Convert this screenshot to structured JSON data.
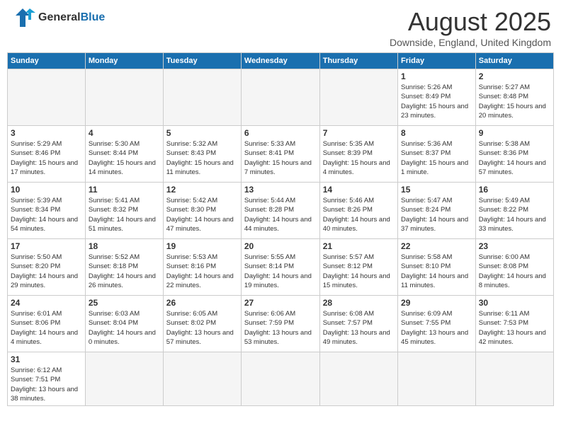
{
  "header": {
    "logo_general": "General",
    "logo_blue": "Blue",
    "month_title": "August 2025",
    "location": "Downside, England, United Kingdom"
  },
  "weekdays": [
    "Sunday",
    "Monday",
    "Tuesday",
    "Wednesday",
    "Thursday",
    "Friday",
    "Saturday"
  ],
  "weeks": [
    [
      {
        "day": "",
        "info": ""
      },
      {
        "day": "",
        "info": ""
      },
      {
        "day": "",
        "info": ""
      },
      {
        "day": "",
        "info": ""
      },
      {
        "day": "",
        "info": ""
      },
      {
        "day": "1",
        "info": "Sunrise: 5:26 AM\nSunset: 8:49 PM\nDaylight: 15 hours\nand 23 minutes."
      },
      {
        "day": "2",
        "info": "Sunrise: 5:27 AM\nSunset: 8:48 PM\nDaylight: 15 hours\nand 20 minutes."
      }
    ],
    [
      {
        "day": "3",
        "info": "Sunrise: 5:29 AM\nSunset: 8:46 PM\nDaylight: 15 hours\nand 17 minutes."
      },
      {
        "day": "4",
        "info": "Sunrise: 5:30 AM\nSunset: 8:44 PM\nDaylight: 15 hours\nand 14 minutes."
      },
      {
        "day": "5",
        "info": "Sunrise: 5:32 AM\nSunset: 8:43 PM\nDaylight: 15 hours\nand 11 minutes."
      },
      {
        "day": "6",
        "info": "Sunrise: 5:33 AM\nSunset: 8:41 PM\nDaylight: 15 hours\nand 7 minutes."
      },
      {
        "day": "7",
        "info": "Sunrise: 5:35 AM\nSunset: 8:39 PM\nDaylight: 15 hours\nand 4 minutes."
      },
      {
        "day": "8",
        "info": "Sunrise: 5:36 AM\nSunset: 8:37 PM\nDaylight: 15 hours\nand 1 minute."
      },
      {
        "day": "9",
        "info": "Sunrise: 5:38 AM\nSunset: 8:36 PM\nDaylight: 14 hours\nand 57 minutes."
      }
    ],
    [
      {
        "day": "10",
        "info": "Sunrise: 5:39 AM\nSunset: 8:34 PM\nDaylight: 14 hours\nand 54 minutes."
      },
      {
        "day": "11",
        "info": "Sunrise: 5:41 AM\nSunset: 8:32 PM\nDaylight: 14 hours\nand 51 minutes."
      },
      {
        "day": "12",
        "info": "Sunrise: 5:42 AM\nSunset: 8:30 PM\nDaylight: 14 hours\nand 47 minutes."
      },
      {
        "day": "13",
        "info": "Sunrise: 5:44 AM\nSunset: 8:28 PM\nDaylight: 14 hours\nand 44 minutes."
      },
      {
        "day": "14",
        "info": "Sunrise: 5:46 AM\nSunset: 8:26 PM\nDaylight: 14 hours\nand 40 minutes."
      },
      {
        "day": "15",
        "info": "Sunrise: 5:47 AM\nSunset: 8:24 PM\nDaylight: 14 hours\nand 37 minutes."
      },
      {
        "day": "16",
        "info": "Sunrise: 5:49 AM\nSunset: 8:22 PM\nDaylight: 14 hours\nand 33 minutes."
      }
    ],
    [
      {
        "day": "17",
        "info": "Sunrise: 5:50 AM\nSunset: 8:20 PM\nDaylight: 14 hours\nand 29 minutes."
      },
      {
        "day": "18",
        "info": "Sunrise: 5:52 AM\nSunset: 8:18 PM\nDaylight: 14 hours\nand 26 minutes."
      },
      {
        "day": "19",
        "info": "Sunrise: 5:53 AM\nSunset: 8:16 PM\nDaylight: 14 hours\nand 22 minutes."
      },
      {
        "day": "20",
        "info": "Sunrise: 5:55 AM\nSunset: 8:14 PM\nDaylight: 14 hours\nand 19 minutes."
      },
      {
        "day": "21",
        "info": "Sunrise: 5:57 AM\nSunset: 8:12 PM\nDaylight: 14 hours\nand 15 minutes."
      },
      {
        "day": "22",
        "info": "Sunrise: 5:58 AM\nSunset: 8:10 PM\nDaylight: 14 hours\nand 11 minutes."
      },
      {
        "day": "23",
        "info": "Sunrise: 6:00 AM\nSunset: 8:08 PM\nDaylight: 14 hours\nand 8 minutes."
      }
    ],
    [
      {
        "day": "24",
        "info": "Sunrise: 6:01 AM\nSunset: 8:06 PM\nDaylight: 14 hours\nand 4 minutes."
      },
      {
        "day": "25",
        "info": "Sunrise: 6:03 AM\nSunset: 8:04 PM\nDaylight: 14 hours\nand 0 minutes."
      },
      {
        "day": "26",
        "info": "Sunrise: 6:05 AM\nSunset: 8:02 PM\nDaylight: 13 hours\nand 57 minutes."
      },
      {
        "day": "27",
        "info": "Sunrise: 6:06 AM\nSunset: 7:59 PM\nDaylight: 13 hours\nand 53 minutes."
      },
      {
        "day": "28",
        "info": "Sunrise: 6:08 AM\nSunset: 7:57 PM\nDaylight: 13 hours\nand 49 minutes."
      },
      {
        "day": "29",
        "info": "Sunrise: 6:09 AM\nSunset: 7:55 PM\nDaylight: 13 hours\nand 45 minutes."
      },
      {
        "day": "30",
        "info": "Sunrise: 6:11 AM\nSunset: 7:53 PM\nDaylight: 13 hours\nand 42 minutes."
      }
    ],
    [
      {
        "day": "31",
        "info": "Sunrise: 6:12 AM\nSunset: 7:51 PM\nDaylight: 13 hours\nand 38 minutes."
      },
      {
        "day": "",
        "info": ""
      },
      {
        "day": "",
        "info": ""
      },
      {
        "day": "",
        "info": ""
      },
      {
        "day": "",
        "info": ""
      },
      {
        "day": "",
        "info": ""
      },
      {
        "day": "",
        "info": ""
      }
    ]
  ]
}
